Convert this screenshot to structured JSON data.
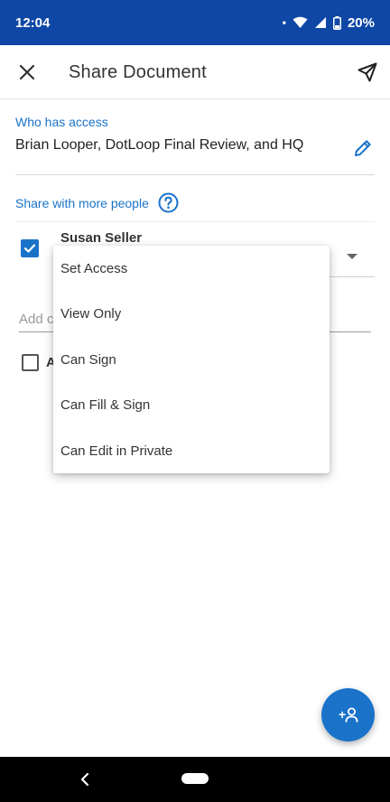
{
  "status_bar": {
    "time": "12:04",
    "dot": "•",
    "battery": "20%"
  },
  "app_bar": {
    "title": "Share Document"
  },
  "access": {
    "label": "Who has access",
    "value": "Brian Looper, DotLoop Final Review, and HQ"
  },
  "share_more": {
    "label": "Share with more people"
  },
  "person": {
    "name": "Susan Seller",
    "checked": true
  },
  "add_input": {
    "visible_text": "Add c"
  },
  "option": {
    "visible_text": "A",
    "checked": false
  },
  "menu": {
    "items": [
      "Set Access",
      "View Only",
      "Can Sign",
      "Can Fill & Sign",
      "Can Edit in Private"
    ]
  },
  "fab": {
    "label": "+"
  },
  "colors": {
    "status_bar": "#0f47a6",
    "accent": "#1a73c9",
    "nav_bar": "#000000"
  },
  "icons": [
    "close-icon",
    "send-icon",
    "edit-pencil-icon",
    "help-circle-icon",
    "check-icon",
    "add-person-icon",
    "back-icon",
    "wifi-icon",
    "signal-icon",
    "battery-icon"
  ]
}
